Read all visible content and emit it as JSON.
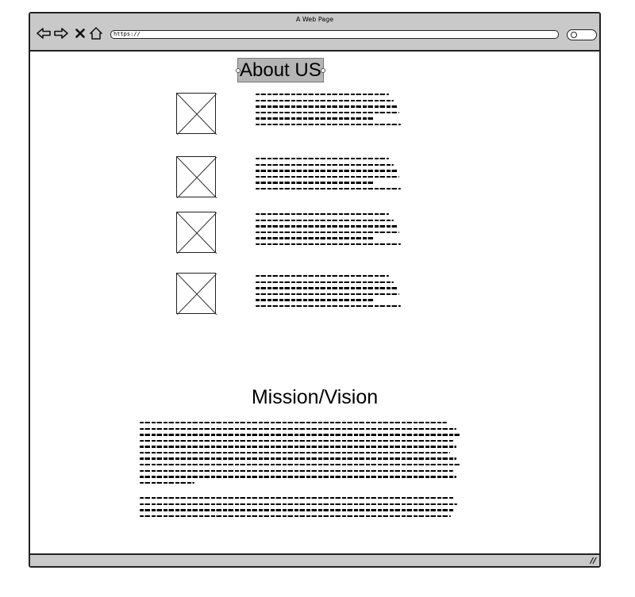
{
  "window": {
    "title": "A Web Page",
    "url": "https://"
  },
  "toolbar": {
    "icons": [
      "back-arrow-icon",
      "forward-arrow-icon",
      "close-icon",
      "home-icon",
      "search-icon"
    ]
  },
  "about": {
    "heading": "About US",
    "items": [
      {
        "image": "image-placeholder",
        "text_lines": 6
      },
      {
        "image": "image-placeholder",
        "text_lines": 6
      },
      {
        "image": "image-placeholder",
        "text_lines": 6
      },
      {
        "image": "image-placeholder",
        "text_lines": 6
      }
    ]
  },
  "mission": {
    "heading": "Mission/Vision",
    "paragraphs": [
      {
        "text_lines": 11
      },
      {
        "text_lines": 4
      }
    ]
  },
  "statusbar": {
    "grip_icon": "resize-grip-icon"
  }
}
